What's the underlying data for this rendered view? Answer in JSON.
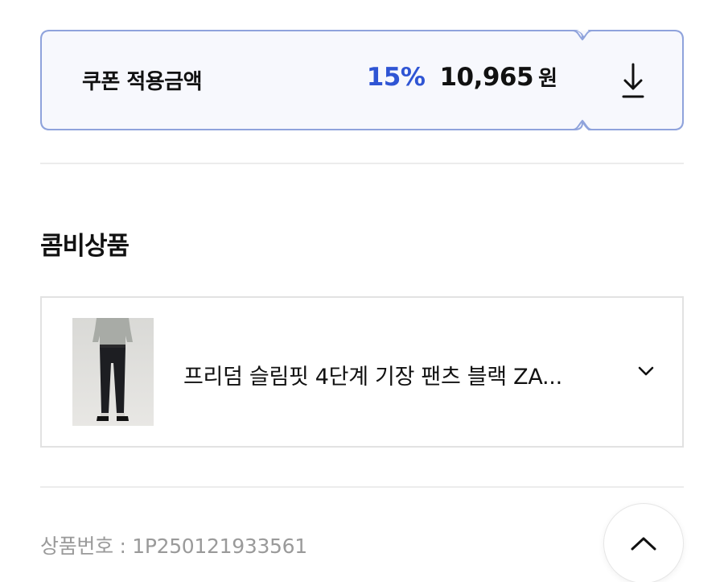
{
  "coupon": {
    "label": "쿠폰 적용금액",
    "discount_percent": "15%",
    "price": "10,965",
    "currency": "원",
    "download_icon": "download-arrow-icon",
    "accent_color": "#2f55d4",
    "border_color": "#8fa3dc",
    "background_color": "#f7f8fd"
  },
  "combo_section": {
    "title": "콤비상품",
    "selected_product": {
      "name": "프리덤 슬림핏 4단계 기장 팬츠 블랙 ZA...",
      "thumbnail": "pants-model-thumbnail",
      "chevron_icon": "chevron-down-icon"
    }
  },
  "product_info": {
    "product_number": "상품번호 : 1P250121933561"
  },
  "scroll_top": {
    "icon": "chevron-up-icon"
  }
}
